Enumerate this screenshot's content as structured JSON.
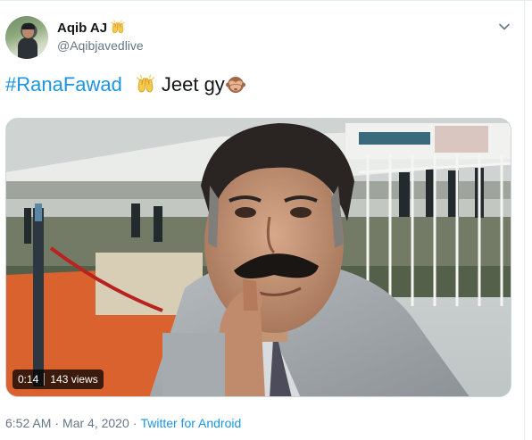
{
  "tweet": {
    "display_name": "Aqib AJ",
    "handle": "@Aqibjavedlive",
    "hashtag": "#RanaFawad",
    "text": "Jeet gy",
    "emoji": {
      "name_badge": "raising-hands-icon",
      "text_hands": "raising-hands-icon",
      "text_monkey": "see-no-evil-monkey-icon"
    }
  },
  "media": {
    "duration": "0:14",
    "views": "143 views"
  },
  "meta": {
    "time": "6:52 AM",
    "separator_1": "·",
    "date": "Mar 4, 2020",
    "separator_2": "·",
    "source": "Twitter for Android"
  },
  "colors": {
    "link": "#1b95e0",
    "secondary": "#657786",
    "primary": "#14171a"
  }
}
